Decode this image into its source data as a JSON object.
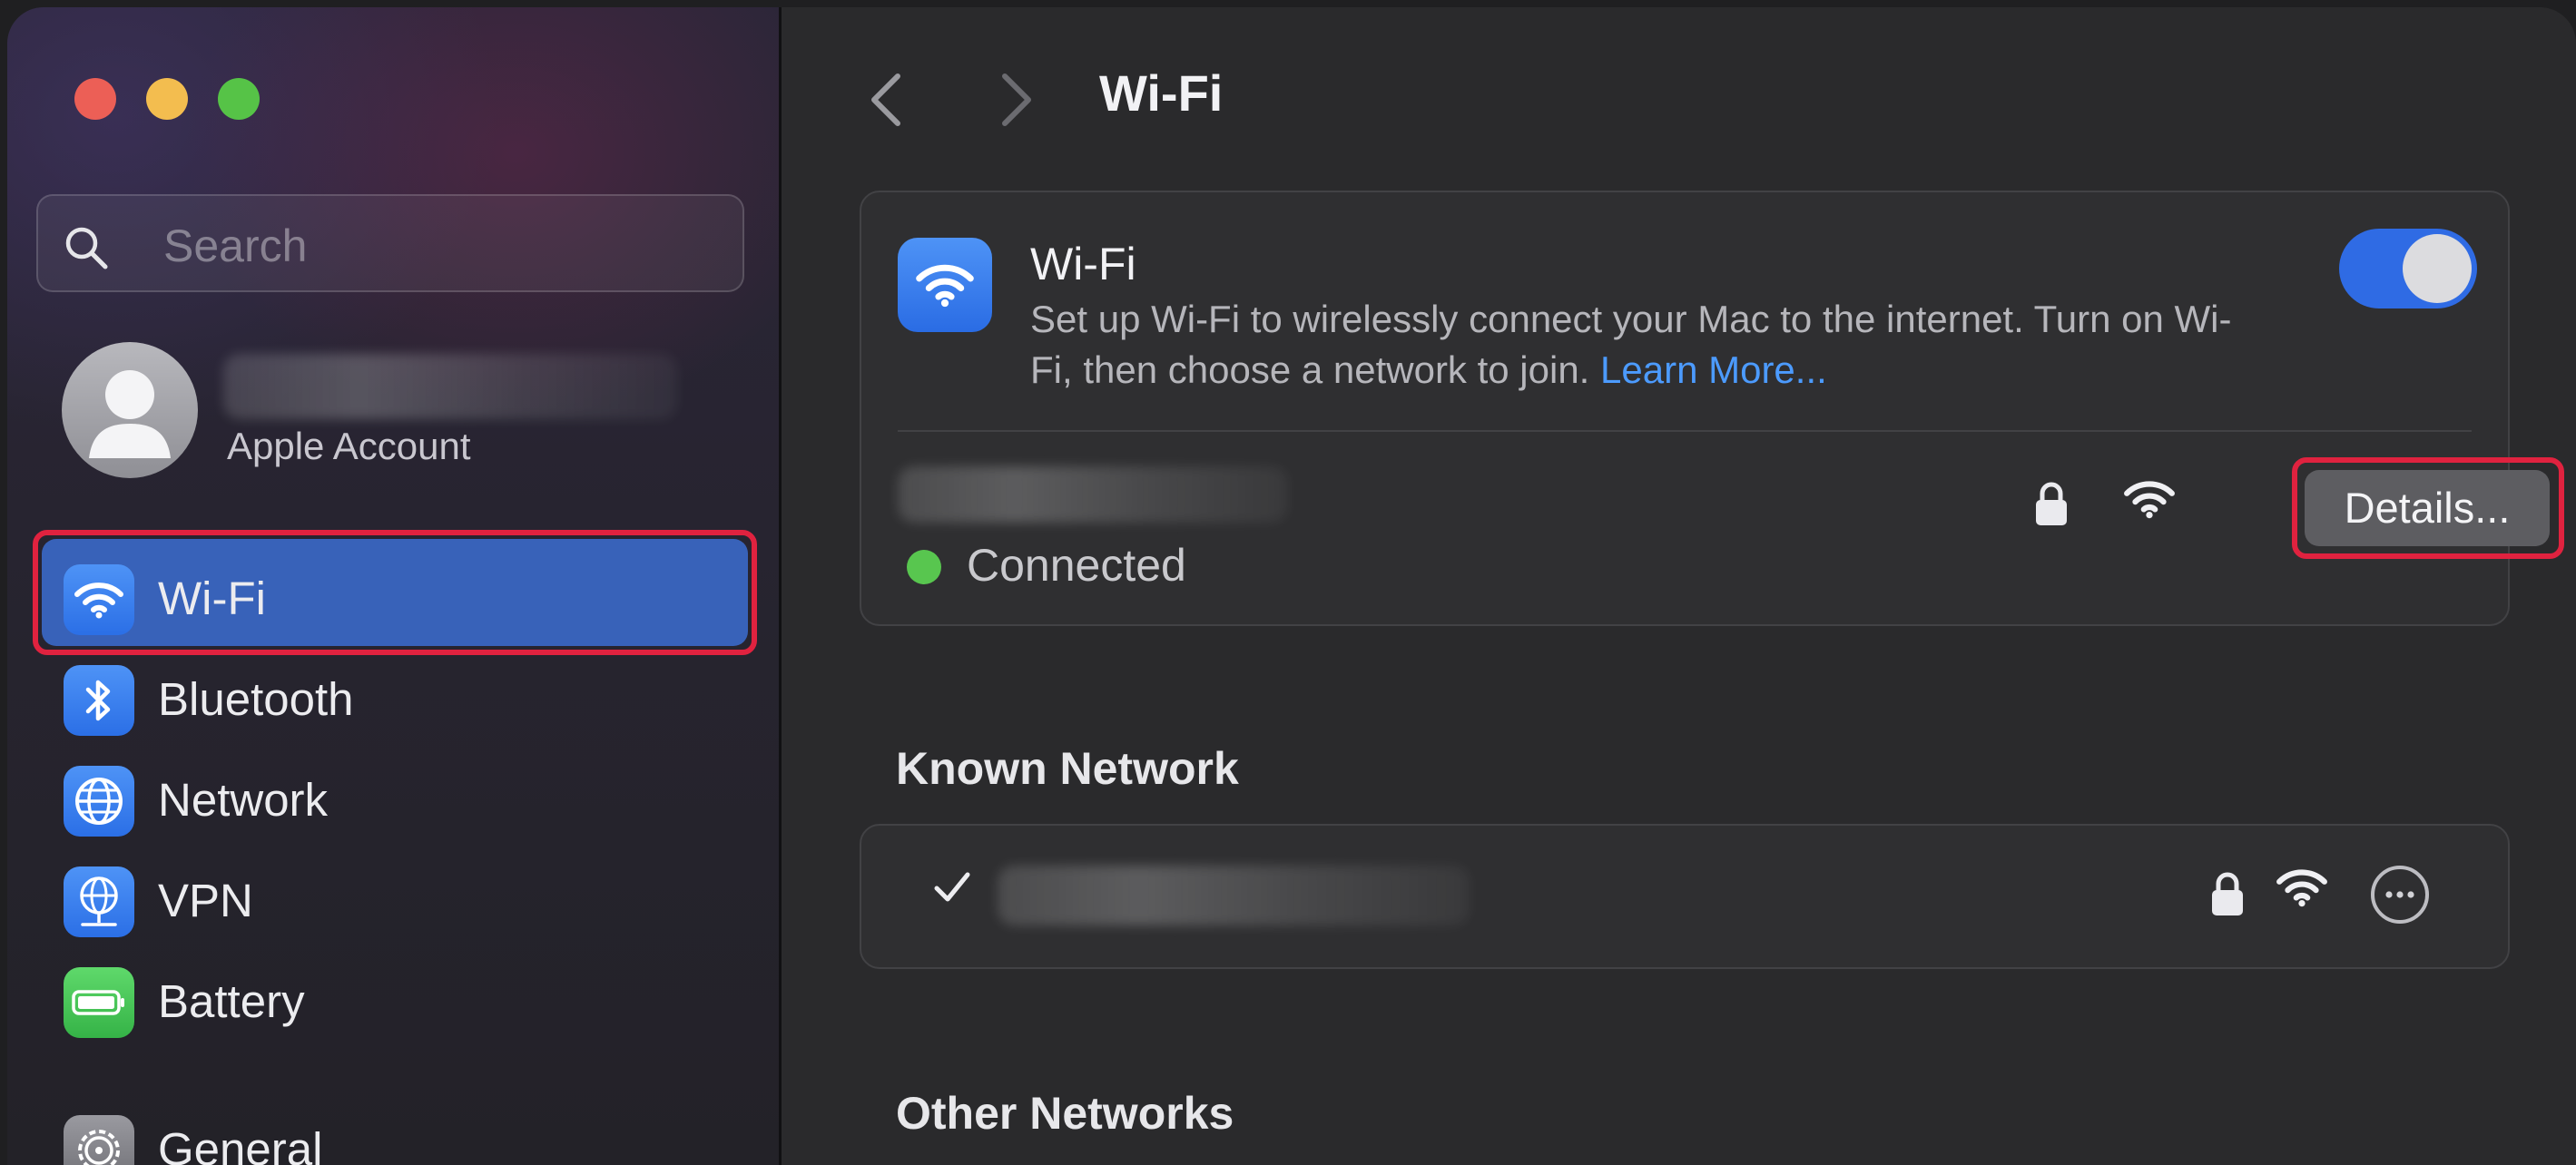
{
  "window": {
    "title": "Wi-Fi"
  },
  "sidebar": {
    "search": {
      "placeholder": "Search"
    },
    "account": {
      "subtitle": "Apple Account"
    },
    "items": [
      {
        "label": "Wi-Fi",
        "icon": "wifi-icon",
        "selected": true
      },
      {
        "label": "Bluetooth",
        "icon": "bluetooth-icon",
        "selected": false
      },
      {
        "label": "Network",
        "icon": "globe-icon",
        "selected": false
      },
      {
        "label": "VPN",
        "icon": "vpn-globe-icon",
        "selected": false
      },
      {
        "label": "Battery",
        "icon": "battery-icon",
        "selected": false
      },
      {
        "label": "General",
        "icon": "gear-icon",
        "selected": false
      }
    ]
  },
  "main": {
    "wifi_card": {
      "title": "Wi-Fi",
      "description": "Set up Wi-Fi to wirelessly connect your Mac to the internet. Turn on Wi-Fi, then choose a network to join.",
      "learn_more": "Learn More...",
      "toggle_on": true,
      "connection_status": "Connected",
      "details_label": "Details..."
    },
    "known_section_title": "Known Network",
    "other_section_title": "Other Networks"
  },
  "colors": {
    "accent": "#2f6be4",
    "selection": "#3862b9",
    "highlight_box": "#e0223f",
    "connected": "#58c64f",
    "link": "#4c9bff"
  }
}
